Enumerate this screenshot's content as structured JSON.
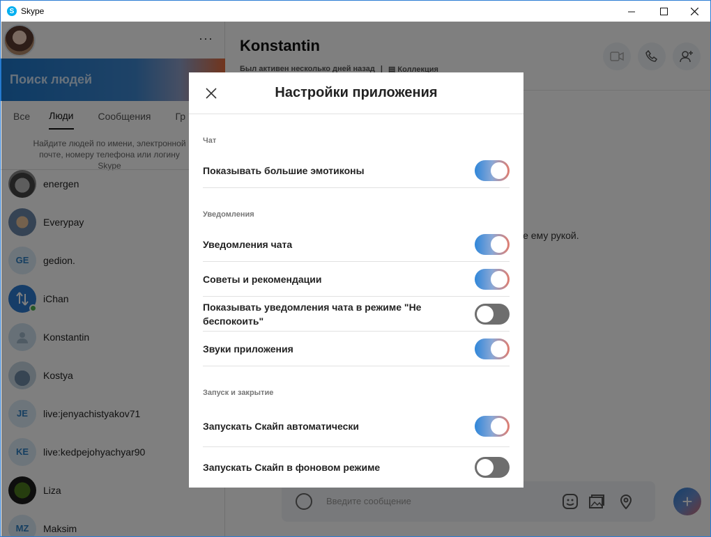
{
  "window": {
    "title": "Skype",
    "controls": {
      "minimize": "—",
      "maximize": "☐",
      "close": "✕"
    }
  },
  "sidebar": {
    "more_label": "···",
    "search_placeholder": "Поиск людей",
    "tabs": [
      {
        "label": "Все"
      },
      {
        "label": "Люди",
        "active": true
      },
      {
        "label": "Сообщения"
      },
      {
        "label": "Гр"
      }
    ],
    "hint": "Найдите людей по имени, электронной почте, номеру телефона или логину Skype",
    "contacts": [
      {
        "name": "energen",
        "avatar": "photo"
      },
      {
        "name": "Everypay",
        "avatar": "photo"
      },
      {
        "name": "gedion.",
        "avatar": "GE"
      },
      {
        "name": "iChan",
        "avatar": "photo",
        "online": true
      },
      {
        "name": "Konstantin",
        "avatar": "person"
      },
      {
        "name": "Kostya",
        "avatar": "photo"
      },
      {
        "name": "live:jenyachistyakov71",
        "avatar": "JE"
      },
      {
        "name": "live:kedpejohyachyar90",
        "avatar": "KE"
      },
      {
        "name": "Liza",
        "avatar": "photo"
      },
      {
        "name": "Maksim",
        "avatar": "MZ"
      }
    ]
  },
  "chat": {
    "contact_name": "Konstantin",
    "status": "Был активен несколько дней назад",
    "separator": "|",
    "collection_label": "Коллекция",
    "wave_text": "ите ему рукой.",
    "message_placeholder": "Введите сообщение",
    "send_label": "+"
  },
  "settings_dialog": {
    "title": "Настройки приложения",
    "sections": [
      {
        "label": "Чат",
        "items": [
          {
            "label": "Показывать большие эмотиконы",
            "enabled": true
          }
        ]
      },
      {
        "label": "Уведомления",
        "items": [
          {
            "label": "Уведомления чата",
            "enabled": true
          },
          {
            "label": "Советы и рекомендации",
            "enabled": true
          },
          {
            "label": "Показывать уведомления чата в режиме \"Не беспокоить\"",
            "enabled": false
          },
          {
            "label": "Звуки приложения",
            "enabled": true
          }
        ]
      },
      {
        "label": "Запуск и закрытие",
        "items": [
          {
            "label": "Запускать Скайп автоматически",
            "enabled": true
          },
          {
            "label": "Запускать Скайп в фоновом режиме",
            "enabled": false
          }
        ]
      }
    ]
  },
  "colors": {
    "skype_blue": "#00aff0",
    "accent": "#2f86d9",
    "toggle_off": "#6e6e6e",
    "online": "#4caf50"
  }
}
